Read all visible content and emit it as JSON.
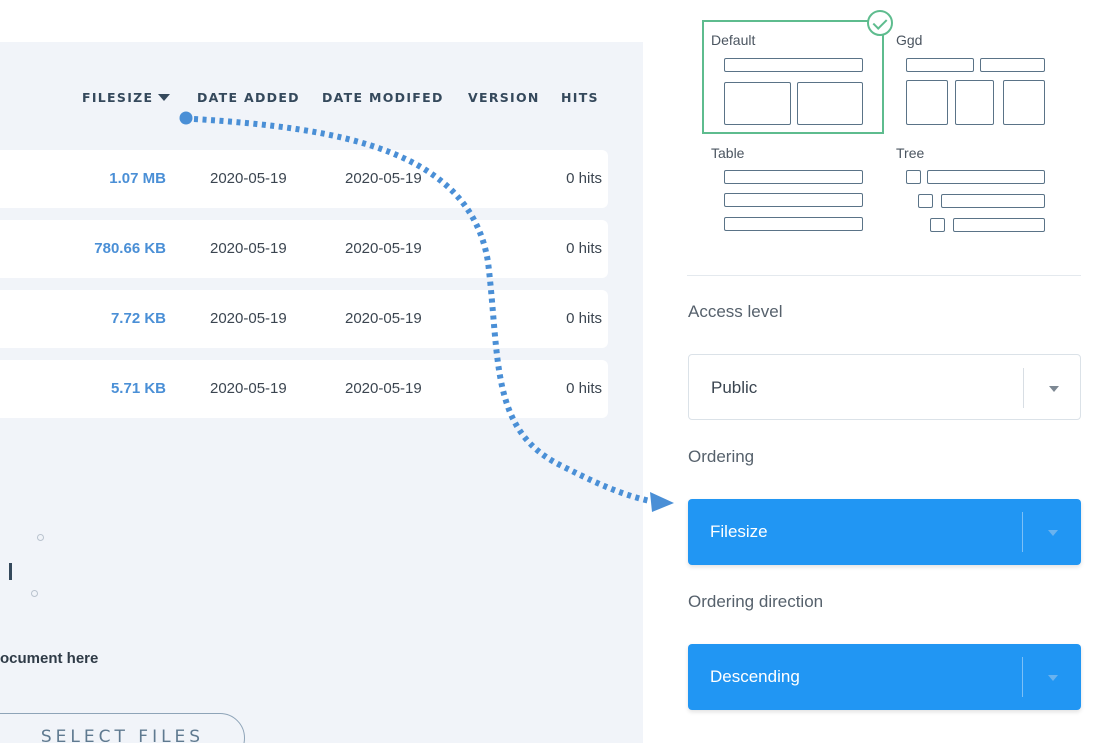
{
  "file_table": {
    "columns": {
      "filesize": "FILESIZE",
      "date_added": "DATE ADDED",
      "date_modified": "DATE MODIFED",
      "version": "VERSION",
      "hits": "HITS"
    },
    "rows": [
      {
        "filesize": "1.07 MB",
        "date_added": "2020-05-19",
        "date_modified": "2020-05-19",
        "hits": "0 hits"
      },
      {
        "filesize": "780.66 KB",
        "date_added": "2020-05-19",
        "date_modified": "2020-05-19",
        "hits": "0 hits"
      },
      {
        "filesize": "7.72 KB",
        "date_added": "2020-05-19",
        "date_modified": "2020-05-19",
        "hits": "0 hits"
      },
      {
        "filesize": "5.71 KB",
        "date_added": "2020-05-19",
        "date_modified": "2020-05-19",
        "hits": "0 hits"
      }
    ]
  },
  "upload": {
    "drop_text": "ocument here",
    "select_files_label": "SELECT FILES"
  },
  "layouts": {
    "default_label": "Default",
    "ggd_label": "Ggd",
    "table_label": "Table",
    "tree_label": "Tree",
    "selected": "Default"
  },
  "settings": {
    "access_level_label": "Access level",
    "access_level_value": "Public",
    "ordering_label": "Ordering",
    "ordering_value": "Filesize",
    "ordering_direction_label": "Ordering direction",
    "ordering_direction_value": "Descending"
  },
  "colors": {
    "accent_blue": "#2196f3",
    "selected_green": "#5ebc8e",
    "annotation_blue": "#4a8fd6"
  }
}
